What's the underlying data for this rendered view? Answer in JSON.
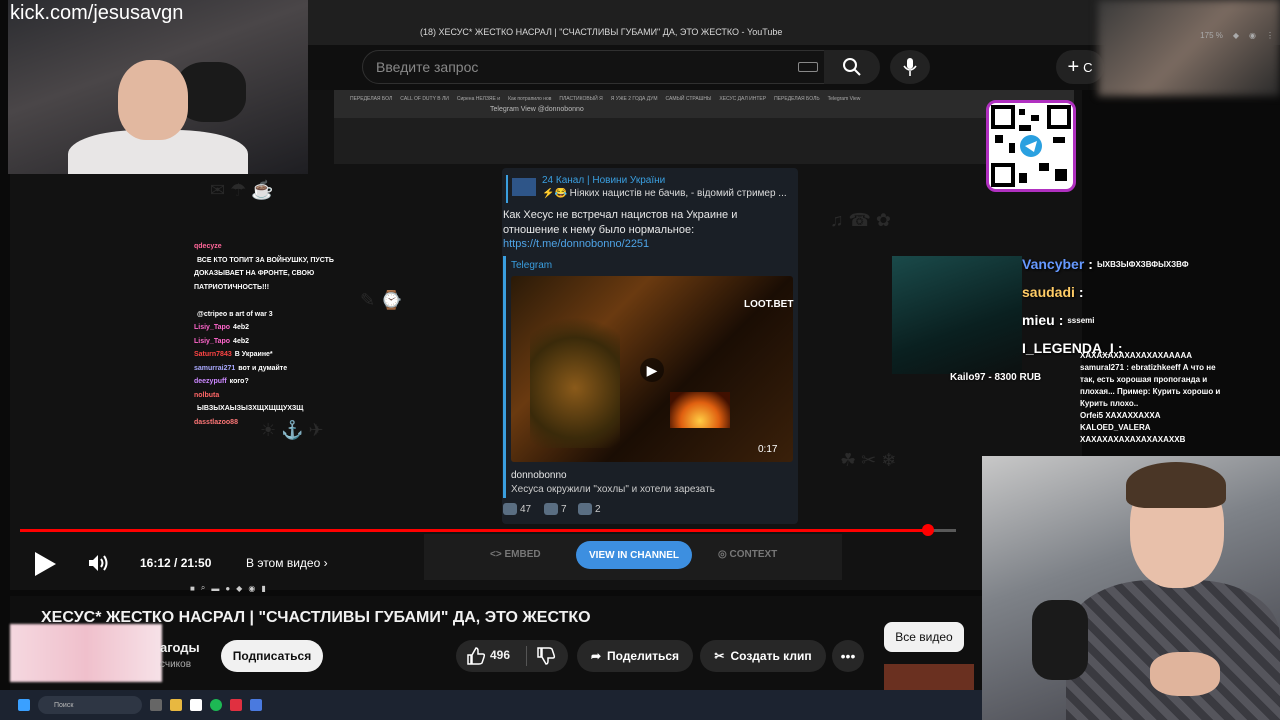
{
  "browser": {
    "tab_title": "(18) ХЕСУС* ЖЕСТКО НАСРАЛ | \"СЧАСТЛИВЫ ГУБАМИ\" ДА, ЭТО ЖЕСТКО - YouTube",
    "zoom": "175 %",
    "inner_tabs": [
      "ПЕРЕДЕЛАЯ БОЛ",
      "CALL OF DUTY В ЛИ",
      "Сирена НЕЛЗЯЕ и",
      "Как потрапило нов",
      "ПЛАСТИКОВЫЙ Я",
      "Я УЖЕ 2 ГОДА ДУМ",
      "САМЫЙ СТРАШНЫ",
      "ХЕСУС ДАЛ ИНТЕР",
      "ПЕРЕДЕЛАЯ БОЛЬ",
      "Telegram View"
    ],
    "inner_title": "Telegram View @donnobonno"
  },
  "youtube": {
    "search_placeholder": "Введите запрос",
    "create_label": "С"
  },
  "kick": {
    "url": "kick.com/jesusavgn"
  },
  "telegram": {
    "forward_source": "24 Канал | Новини України",
    "forward_text": "⚡😂 Ніяких нацистів не бачив, - відомий стример ...",
    "post_text": "Как Хесус не встречал нацистов на Украине и отношение к нему было нормальное:",
    "post_link": "https://t.me/donnobonno/2251",
    "preview_site": "Telegram",
    "thumb_brand": "LOOT.BET",
    "thumb_duration": "0:17",
    "preview_title": "donnobonno",
    "preview_desc": "Хесуса окружили \"хохлы\" и хотели зарезать",
    "reactions": [
      {
        "count": "47"
      },
      {
        "count": "7"
      },
      {
        "count": "2"
      }
    ],
    "embed_label": "EMBED",
    "view_label": "VIEW IN CHANNEL",
    "context_label": "CONTEXT"
  },
  "left_chat": [
    {
      "name": "qdecyze",
      "color": "#ff6699",
      "text": ""
    },
    {
      "name": "",
      "color": "#9966ff",
      "text": "ВСЕ КТО ТОПИТ ЗА ВОЙНУШКУ, ПУСТЬ ДОКАЗЫВАЕТ НА ФРОНТЕ, СВОЮ ПАТРИОТИЧНОСТЬ!!!"
    },
    {
      "name": "",
      "color": "#cc66ff",
      "text": ""
    },
    {
      "name": "",
      "color": "#ff5555",
      "text": "@ctripeo в art of war 3"
    },
    {
      "name": "Lisiy_Tapo",
      "color": "#ff66cc",
      "text": "4eb2"
    },
    {
      "name": "Lisiy_Tapo",
      "color": "#ff66cc",
      "text": "4eb2"
    },
    {
      "name": "Saturn7843",
      "color": "#ff4444",
      "text": "В Украине*"
    },
    {
      "name": "samurrai271",
      "color": "#aaaaff",
      "text": "вот и думайте"
    },
    {
      "name": "deezypuff",
      "color": "#cc88ff",
      "text": "кого?"
    },
    {
      "name": "nolbuta",
      "color": "#ff6666",
      "text": ""
    },
    {
      "name": "",
      "color": "#ffffff",
      "text": "ЫВЗЫХАЫЗЫЗХЩХЩЩУХЗЩ"
    },
    {
      "name": "dasstlazoo88",
      "color": "#ff7777",
      "text": ""
    }
  ],
  "player": {
    "time": "16:12 / 21:50",
    "chapters": "В этом видео",
    "progress": 0.97
  },
  "video": {
    "title": "ХЕСУС* ЖЕСТКО НАСРАЛ | \"СЧАСТЛИВЫ ГУБАМИ\" ДА, ЭТО ЖЕСТКО",
    "channel": "агоды",
    "subs": "счиков",
    "subscribe": "Подписаться",
    "likes": "496",
    "share": "Поделиться",
    "clip": "Создать клип",
    "all_videos": "Все видео"
  },
  "taskbar": {
    "search": "Поиск"
  },
  "small_cam": {
    "label": "Kailo97 - 8300 RUB"
  },
  "right_chat": [
    {
      "name": "Vancyber",
      "color": "#6699ff",
      "text": "ЫХВЗЫФХЗВФЫХЗВФ"
    },
    {
      "name": "saudadi",
      "color": "#ffcc66",
      "text": ""
    },
    {
      "name": "mieu",
      "color": "#ffffff",
      "text": "sssemi"
    },
    {
      "name": "I_LEGENDA_I",
      "color": "#ffffff",
      "text": ""
    }
  ],
  "right_chat_lines": [
    "ХАХАХАХАХАХАХАХААААА",
    "samural271 : ebratizhkeeff А что не",
    "так, есть хорошая пропоганда и",
    "плохая... Пример: Курить хорошо и",
    "Курить плохо..",
    "Orfei5 ХАХАХХАХХА",
    "KALOED_VALERA",
    "ХАХАХАХАХАХАХАХАХХВ"
  ]
}
